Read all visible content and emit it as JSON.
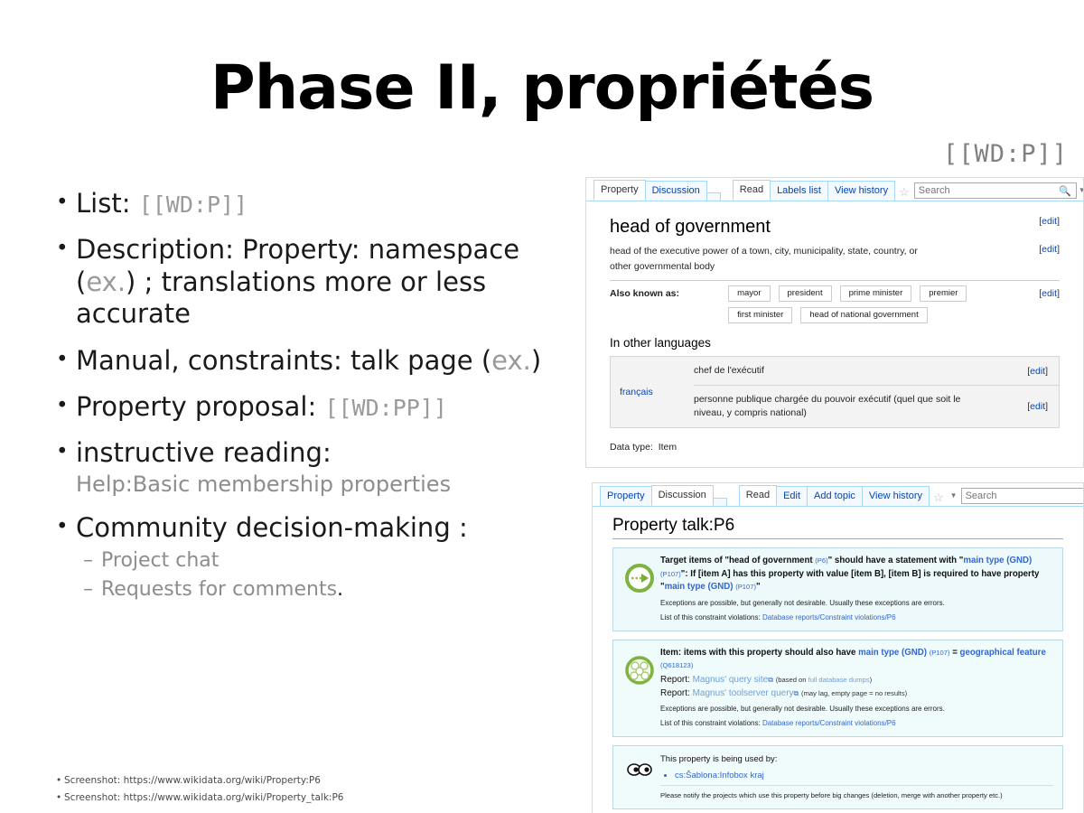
{
  "slide": {
    "title": "Phase II, propriétés",
    "wd_tag": "[[WD:P]]",
    "bullets": [
      {
        "label": "List: ",
        "mono": "[[WD:P]]"
      },
      {
        "label": "Description: Property: namespace (",
        "grey": "ex.",
        "label2": ")  ; translations more or less accurate"
      },
      {
        "label": "Manual, constraints: talk page (",
        "grey": "ex.",
        "label2": ")"
      },
      {
        "label": "Property proposal: ",
        "mono": "[[WD:PP]]"
      },
      {
        "label": "instructive reading:",
        "sub": "Help:Basic membership properties"
      },
      {
        "label": "Community decision-making  :"
      }
    ],
    "sub_bullets": [
      {
        "dash": "–",
        "text": "Project chat",
        "tail": ""
      },
      {
        "dash": "–",
        "text": "Requests for comments",
        "tail": "."
      }
    ],
    "footnotes": [
      "Screenshot: https://www.wikidata.org/wiki/Property:P6",
      "Screenshot: https://www.wikidata.org/wiki/Property_talk:P6"
    ]
  },
  "shot1": {
    "tabs_left": [
      "Property",
      "Discussion"
    ],
    "tabs_right": [
      "Read",
      "Labels list",
      "View history"
    ],
    "star_icon": "star-icon",
    "caret_icon": "chevron-down-icon",
    "search": {
      "placeholder": "Search",
      "value": "",
      "icon": "search-icon"
    },
    "property_title": "head of government",
    "edit_label": "[edit]",
    "edit_bracket_open": "[",
    "edit_bracket_close": "]",
    "edit_word": "edit",
    "description": "head of the executive power of a town, city, municipality, state, country, or other governmental body",
    "aka_label": "Also known as:",
    "aka": [
      "mayor",
      "president",
      "prime minister",
      "premier",
      "first minister",
      "head of national government"
    ],
    "other_languages_heading": "In other languages",
    "language_name": "français",
    "lang_label": "chef de l'exécutif",
    "lang_description": "personne publique chargée du pouvoir exécutif (quel que soit le niveau, y compris national)",
    "datatype_label": "Data type:",
    "datatype_value": "Item"
  },
  "shot2": {
    "tabs_left": [
      "Property",
      "Discussion"
    ],
    "tabs_right": [
      "Read",
      "Edit",
      "Add topic",
      "View history"
    ],
    "star_icon": "star-icon",
    "caret_icon": "chevron-down-icon",
    "search": {
      "placeholder": "Search",
      "value": "",
      "icon": "search-icon"
    },
    "page_title": "Property talk:P6",
    "box1": {
      "icon": "green-arrow-icon",
      "title_a": "Target items of \"head of government ",
      "title_pid1": "(P6)",
      "title_b": "\" should have a statement with \"",
      "title_link1": "main type (GND)",
      "title_pid2": "(P107)",
      "title_c": "\": If [item A] has this property with value [item B], [item B] is required to have property \"",
      "title_link2": "main type (GND)",
      "title_pid3": "(P107)",
      "title_d": "\"",
      "note": "Exceptions are possible, but generally not desirable. Usually these exceptions are errors.",
      "violations_label": "List of this constraint violations: ",
      "violations_link": "Database reports/Constraint violations/P6"
    },
    "box2": {
      "icon": "green-circles-icon",
      "title_a": "Item",
      "title_b": ": items with this property should also have ",
      "title_link1": "main type (GND)",
      "title_pid1": "(P107)",
      "title_c": " = ",
      "title_link2": "geographical feature",
      "title_pid2": "(Q618123)",
      "report1_label": "Report: ",
      "report1_link": "Magnus' query site",
      "report1_ext": "⧉",
      "report1_note_a": "(based on ",
      "report1_note_link": "full database dumps",
      "report1_note_b": ")",
      "report2_label": "Report: ",
      "report2_link": "Magnus' toolserver query",
      "report2_ext": "⧉",
      "report2_note": "(may lag, empty page = no results)",
      "note": "Exceptions are possible, but generally not desirable. Usually these exceptions are errors.",
      "violations_label": "List of this constraint violations: ",
      "violations_link": "Database reports/Constraint violations/P6"
    },
    "box3": {
      "icon": "eyes-icon",
      "heading": "This property is being used by:",
      "items": [
        "cs:Šablona:Infobox kraj"
      ],
      "footer": "Please notify the projects which use this property before big changes (deletion, merge with another property etc.)"
    }
  },
  "colors": {
    "wiki_link": "#3366cc",
    "wiki_link_alt": "#0645ad",
    "tab_border": "#a7d7f9",
    "constraint_bg": "#eef9fc",
    "constraint_border": "#bcd8e6",
    "green_icon": "#7fb23f",
    "muted_text": "#9a9a9a"
  }
}
